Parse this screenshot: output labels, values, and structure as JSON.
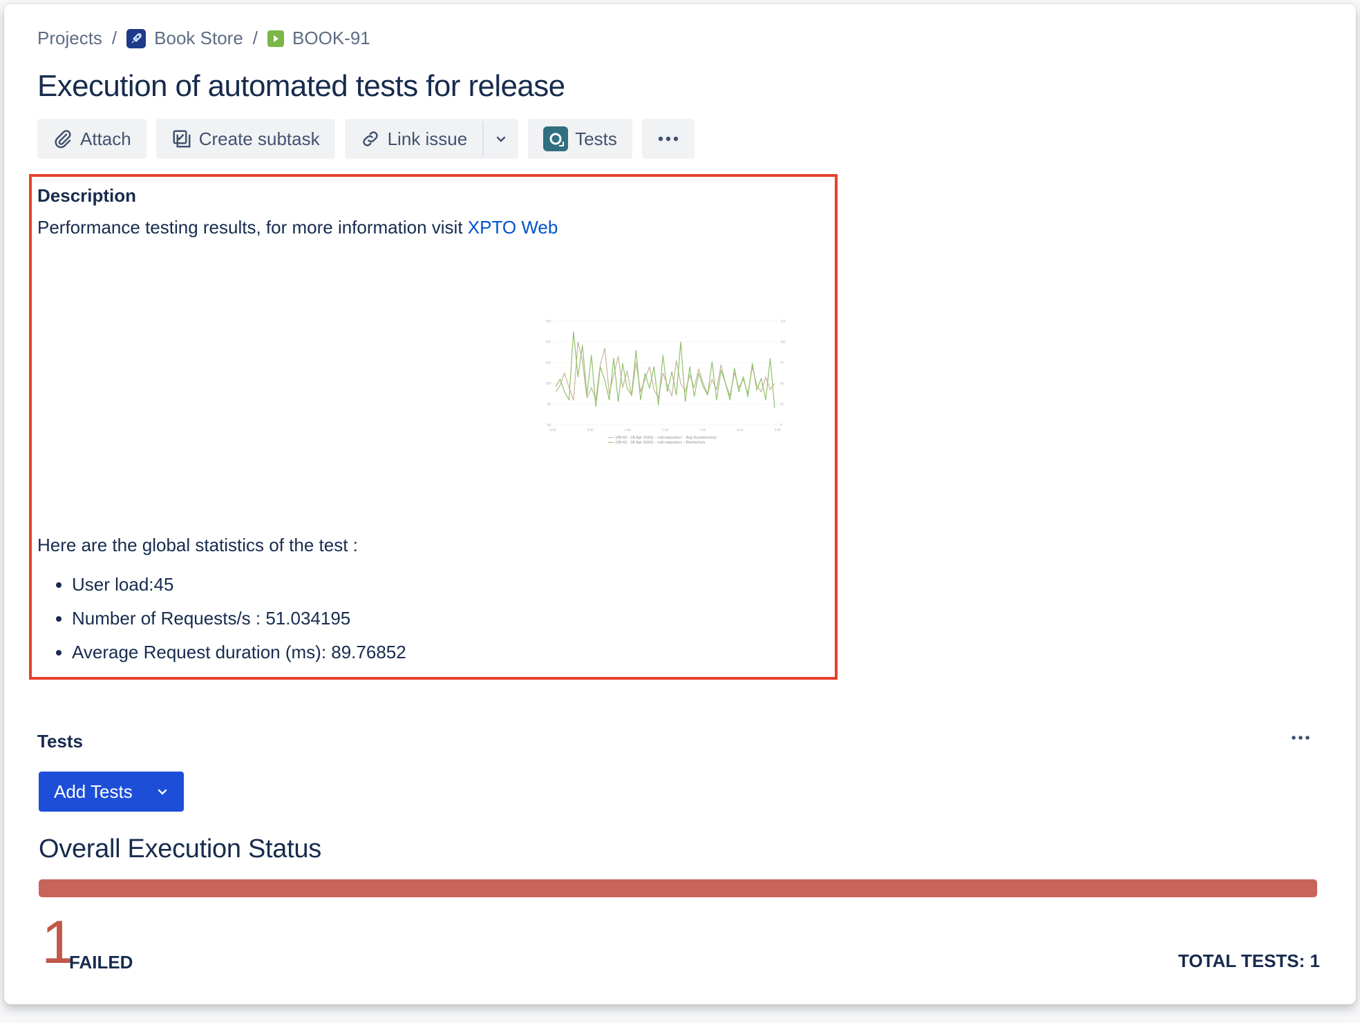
{
  "breadcrumb": {
    "projects": "Projects",
    "separator": "/",
    "project_name": "Book Store",
    "project_icon": "rocket-icon",
    "issue_key": "BOOK-91",
    "issue_icon": "play-icon"
  },
  "issue": {
    "title": "Execution of automated tests for release"
  },
  "toolbar": {
    "attach_label": "Attach",
    "create_subtask_label": "Create subtask",
    "link_issue_label": "Link issue",
    "tests_label": "Tests",
    "more_icon": "more-horizontal-icon"
  },
  "description": {
    "heading": "Description",
    "intro_text": "Performance testing results, for more information visit ",
    "link_text": "XPTO Web",
    "stats_intro": "Here are the global statistics of the test :",
    "stats": [
      "User load:45",
      "Number of Requests/s : 51.034195",
      "Average Request duration (ms): 89.76852"
    ]
  },
  "chart_data": {
    "type": "line",
    "title": "",
    "xlabel": "",
    "ylabel": "",
    "x": [
      "0:00",
      "0:50",
      "1:40",
      "2:30",
      "3:20",
      "4:10",
      "5:00"
    ],
    "y_left_ticks": [
      "60",
      "80",
      "100",
      "120",
      "140",
      "160"
    ],
    "y_right_ticks": [
      "0",
      "25",
      "50",
      "75",
      "100",
      "125"
    ],
    "ylim_left": [
      60,
      160
    ],
    "ylim_right": [
      0,
      125
    ],
    "legend_placement": "bottom",
    "series": [
      {
        "name": "[09:42 - 28 Apr 2020] - <all-requests> - Avg Duration(ms)",
        "color": "#c8b49a",
        "values": [
          92,
          98,
          110,
          96,
          84,
          140,
          122,
          86,
          96,
          84,
          118,
          134,
          90,
          108,
          126,
          96,
          112,
          88,
          120,
          92,
          104,
          116,
          94,
          86,
          110,
          98,
          88,
          122,
          100,
          92,
          108,
          96,
          114,
          100,
          90,
          104,
          94,
          118,
          100,
          88,
          110,
          96,
          104,
          90,
          116,
          98,
          92,
          106,
          94,
          100
        ]
      },
      {
        "name": "[09:42 - 28 Apr 2020] - <all-requests> - Elements/s",
        "color": "#8fc26a",
        "values": [
          46,
          55,
          40,
          30,
          112,
          58,
          96,
          36,
          84,
          22,
          70,
          54,
          30,
          80,
          28,
          74,
          44,
          36,
          90,
          30,
          62,
          44,
          70,
          24,
          84,
          40,
          64,
          36,
          100,
          28,
          70,
          34,
          62,
          46,
          36,
          76,
          30,
          66,
          50,
          30,
          68,
          40,
          58,
          34,
          74,
          42,
          56,
          30,
          80,
          20
        ]
      }
    ]
  },
  "tests_section": {
    "heading": "Tests",
    "add_tests_label": "Add Tests",
    "more_icon": "more-horizontal-icon"
  },
  "execution_status": {
    "title": "Overall Execution Status",
    "failed_count": "1",
    "failed_label": "FAILED",
    "total_tests_label": "TOTAL TESTS: 1",
    "failed_fraction": 1.0,
    "failed_color": "#c9645a"
  }
}
